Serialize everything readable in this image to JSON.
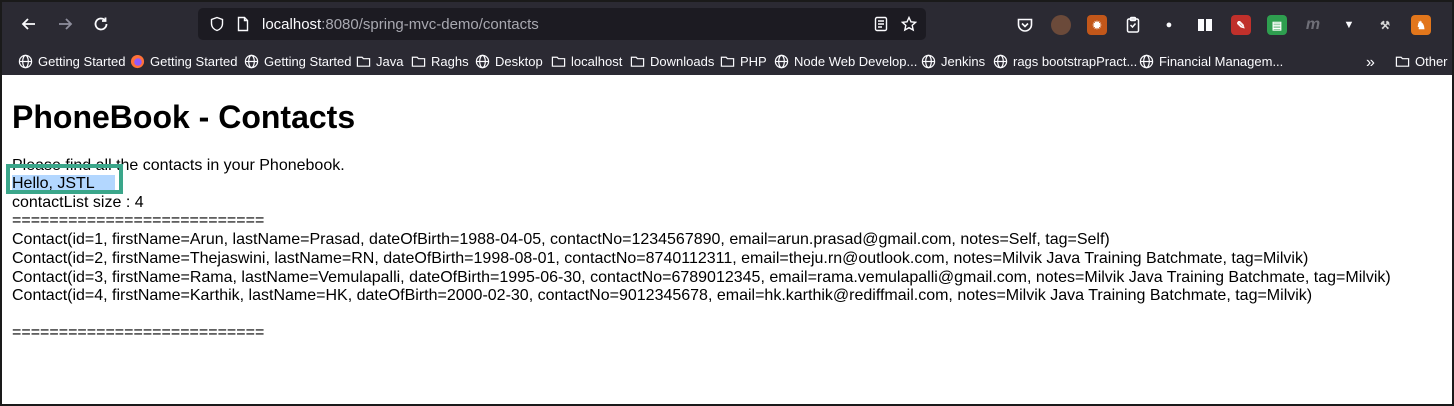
{
  "browser": {
    "url_host": "localhost",
    "url_path": ":8080/spring-mvc-demo/contacts",
    "nav": {
      "back": "back-arrow",
      "forward": "forward-arrow",
      "reload": "reload"
    },
    "bookmarks": [
      {
        "label": "Getting Started",
        "icon": "globe"
      },
      {
        "label": "Getting Started",
        "icon": "firefox"
      },
      {
        "label": "Getting Started",
        "icon": "globe"
      },
      {
        "label": "Java",
        "icon": "folder"
      },
      {
        "label": "Raghs",
        "icon": "folder"
      },
      {
        "label": "Desktop",
        "icon": "globe"
      },
      {
        "label": "localhost",
        "icon": "folder"
      },
      {
        "label": "Downloads",
        "icon": "folder"
      },
      {
        "label": "PHP",
        "icon": "folder"
      },
      {
        "label": "Node Web Develop...",
        "icon": "globe"
      },
      {
        "label": "Jenkins",
        "icon": "globe"
      },
      {
        "label": "rags bootstrapPract...",
        "icon": "globe"
      },
      {
        "label": "Financial Managem...",
        "icon": "globe"
      },
      {
        "label": "Other B",
        "icon": "folder"
      }
    ]
  },
  "page": {
    "title": "PhoneBook - Contacts",
    "intro": "Please find all the contacts in your Phonebook.",
    "greeting": "Hello, JSTL",
    "size_line": "contactList size : 4",
    "separator": "===========================",
    "contacts": [
      "Contact(id=1, firstName=Arun, lastName=Prasad, dateOfBirth=1988-04-05, contactNo=1234567890, email=arun.prasad@gmail.com, notes=Self, tag=Self)",
      "Contact(id=2, firstName=Thejaswini, lastName=RN, dateOfBirth=1998-08-01, contactNo=8740112311, email=theju.rn@outlook.com, notes=Milvik Java Training Batchmate, tag=Milvik)",
      "Contact(id=3, firstName=Rama, lastName=Vemulapalli, dateOfBirth=1995-06-30, contactNo=6789012345, email=rama.vemulapalli@gmail.com, notes=Milvik Java Training Batchmate, tag=Milvik)",
      "Contact(id=4, firstName=Karthik, lastName=HK, dateOfBirth=2000-02-30, contactNo=9012345678, email=hk.karthik@rediffmail.com, notes=Milvik Java Training Batchmate, tag=Milvik)"
    ]
  },
  "colors": {
    "chrome_bg": "#2b2a33",
    "urlbar_bg": "#1c1b22",
    "selection": "#b3d7ff",
    "annotation": "#3aa68a"
  }
}
